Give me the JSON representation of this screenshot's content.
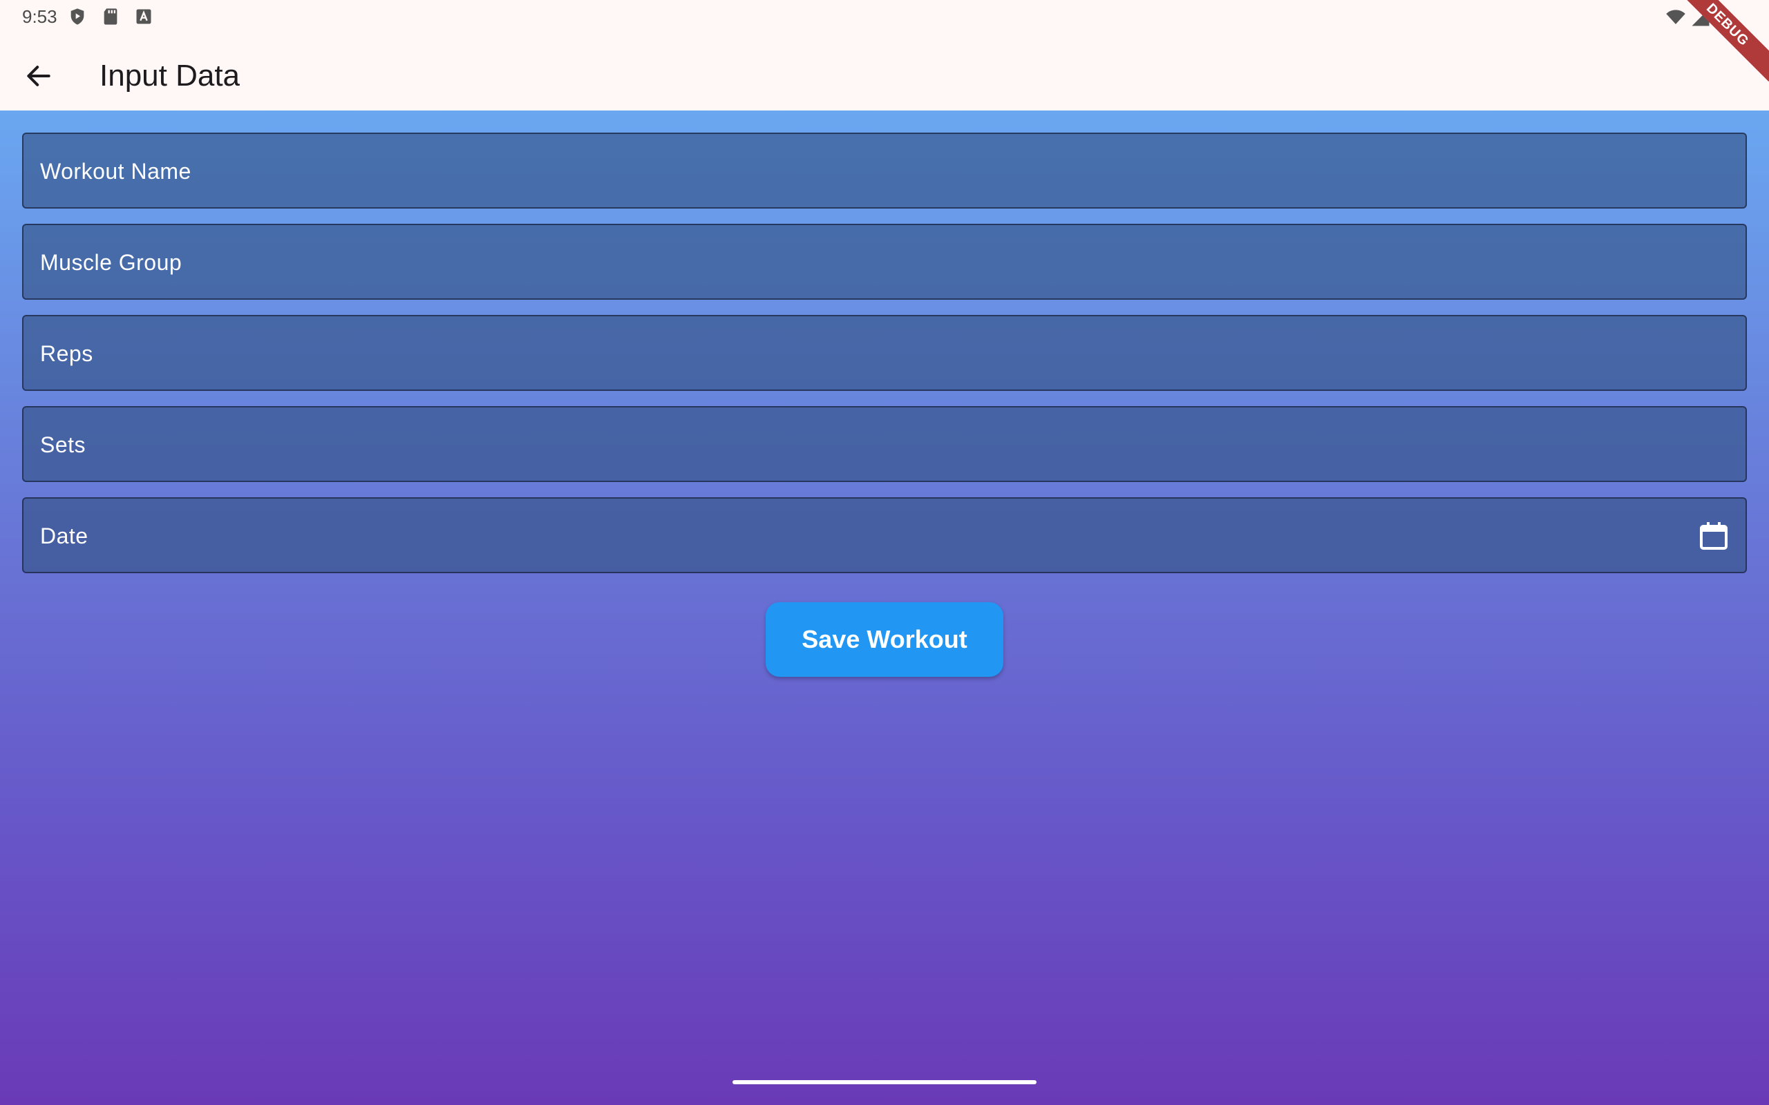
{
  "status_bar": {
    "time": "9:53",
    "left_icons": [
      "shield-play-icon",
      "sd-card-icon",
      "keyboard-a-icon"
    ],
    "right_icons": [
      "wifi-icon",
      "cell-signal-icon",
      "battery-icon"
    ],
    "debug_banner": "DEBUG"
  },
  "app_bar": {
    "title": "Input Data",
    "back_icon": "arrow-back-icon"
  },
  "form": {
    "fields": [
      {
        "label": "Workout Name",
        "value": ""
      },
      {
        "label": "Muscle Group",
        "value": ""
      },
      {
        "label": "Reps",
        "value": ""
      },
      {
        "label": "Sets",
        "value": ""
      },
      {
        "label": "Date",
        "value": "",
        "icon": "calendar-icon"
      }
    ],
    "save_label": "Save Workout"
  },
  "colors": {
    "app_bar_bg": "#fff8f7",
    "gradient_top": "#6bb4f8",
    "gradient_bottom": "#6a3ab6",
    "button": "#2196f3",
    "debug": "#b03a3a"
  }
}
